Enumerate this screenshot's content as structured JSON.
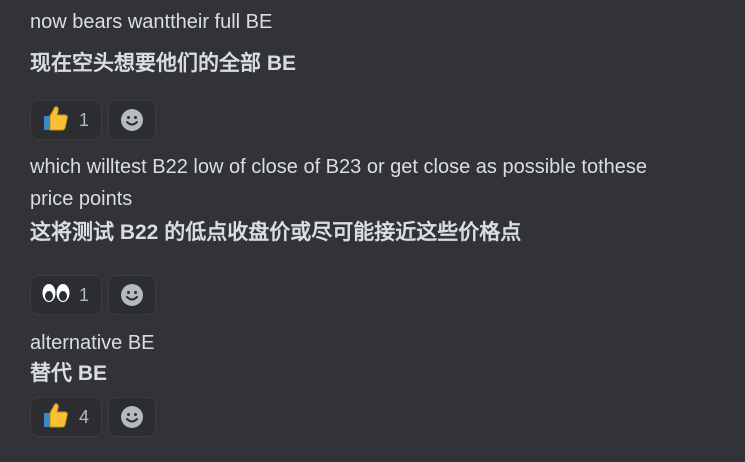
{
  "messages": [
    {
      "en": "now bears wanttheir full BE",
      "zh": "现在空头想要他们的全部 BE",
      "reaction": {
        "emoji_name": "thumbs-up-icon",
        "count": "1"
      }
    },
    {
      "en_line1": "which willtest B22 low of close of B23 or get close as possible tothese",
      "en_line2": "price points",
      "zh": "这将测试 B22 的低点收盘价或尽可能接近这些价格点",
      "reaction": {
        "emoji_name": "eyes-icon",
        "count": "1"
      }
    },
    {
      "en": "alternative BE",
      "zh": "替代 BE",
      "reaction": {
        "emoji_name": "thumbs-up-icon",
        "count": "4"
      }
    }
  ],
  "colors": {
    "background": "#313338",
    "text": "#dbdee1",
    "reaction_bg": "#2b2d31",
    "reaction_border": "#3b3d44",
    "thumb_yellow": "#f7c035"
  }
}
